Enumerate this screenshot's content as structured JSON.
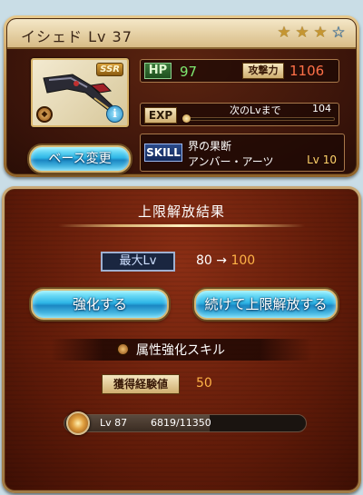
{
  "weapon": {
    "title": "イシェド Lv 37",
    "rarity": "SSR",
    "stars_total": 4,
    "stars_filled": 3,
    "hp_label": "HP",
    "hp": "97",
    "atk_label": "攻撃力",
    "atk": "1106",
    "exp_label": "EXP",
    "next_lv_label": "次のLvまで",
    "next_lv_value": "104",
    "exp_progress": 0.0,
    "skill_label": "SKILL",
    "skill_name_1": "界の果断",
    "skill_name_2": "アンバー・アーツ",
    "skill_lv": "Lv 10",
    "base_change_label": "ベース変更"
  },
  "result": {
    "title": "上限解放結果",
    "max_lv_label": "最大Lv",
    "max_lv_from": "80",
    "arrow": "→",
    "max_lv_to": "100",
    "strengthen_label": "強化する",
    "continue_label": "続けて上限解放する",
    "attr_skill_label": "属性強化スキル",
    "exp_gain_label": "獲得経験値",
    "exp_gain_value": "50",
    "lv_text": "Lv 87",
    "lv_exp_text": "6819/11350",
    "lv_progress": 0.6
  },
  "colors": {
    "hp": "#7ee870",
    "atk": "#ff7048",
    "accent_orange": "#ffb347",
    "button_blue": "#2eb6e6"
  }
}
